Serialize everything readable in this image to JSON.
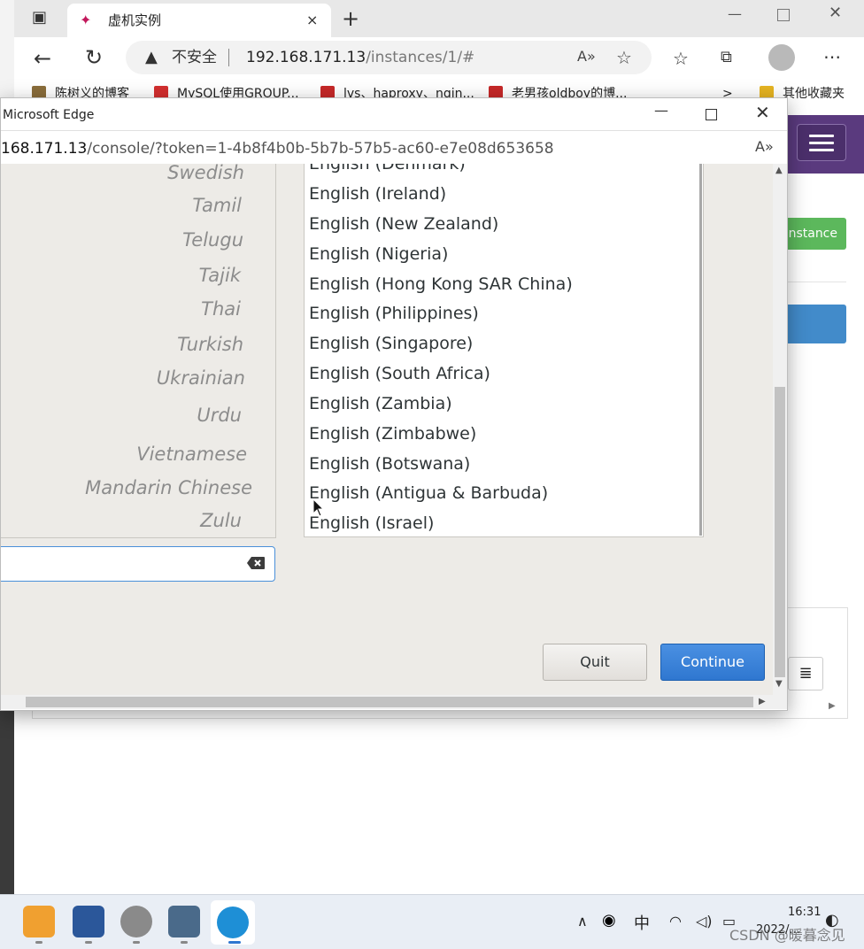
{
  "browser": {
    "tab_title": "虚机实例",
    "tab_close": "×",
    "new_tab": "+",
    "insecure_label": "不安全",
    "url_host": "192.168.171.13",
    "url_path": "/instances/1/#",
    "bookmarks": [
      {
        "label": "陈树义的博客",
        "color": "#8a6d3b"
      },
      {
        "label": "MySQL使用GROUP...",
        "color": "#d32f2f"
      },
      {
        "label": "lvs、haproxy、ngin...",
        "color": "#c62828"
      },
      {
        "label": "老男孩oldboy的博...",
        "color": "#c62828"
      }
    ],
    "bookmarks_more": ">",
    "other_bookmarks": "其他收藏夹",
    "page": {
      "green_button": "nstance",
      "list_icon": "≣"
    }
  },
  "popup": {
    "title": "Microsoft Edge",
    "url_host": "168.171.13",
    "url_path": "/console/?token=1-4b8f4b0b-5b7b-57b5-ac60-e7e08d653658",
    "languages": [
      "Swedish",
      "Tamil",
      "Telugu",
      "Tajik",
      "Thai",
      "Turkish",
      "Ukrainian",
      "Urdu",
      "Vietnamese",
      "Mandarin Chinese",
      "Zulu"
    ],
    "locales": [
      "English (Denmark)",
      "English (Ireland)",
      "English (New Zealand)",
      "English (Nigeria)",
      "English (Hong Kong SAR China)",
      "English (Philippines)",
      "English (Singapore)",
      "English (South Africa)",
      "English (Zambia)",
      "English (Zimbabwe)",
      "English (Botswana)",
      "English (Antigua & Barbuda)",
      "English (Israel)"
    ],
    "search": {
      "value": ""
    },
    "quit_label": "Quit",
    "continue_label": "Continue"
  },
  "taskbar": {
    "ime": "中",
    "time": "16:31",
    "date": "2022/...",
    "watermark": "CSDN @暖暮念见"
  },
  "colors": {
    "continue_blue": "#3584e4",
    "search_focus": "#4a90d9",
    "purple_header": "#5a3a7e",
    "green_button": "#5cb85c",
    "blue_bar": "#428bca"
  }
}
